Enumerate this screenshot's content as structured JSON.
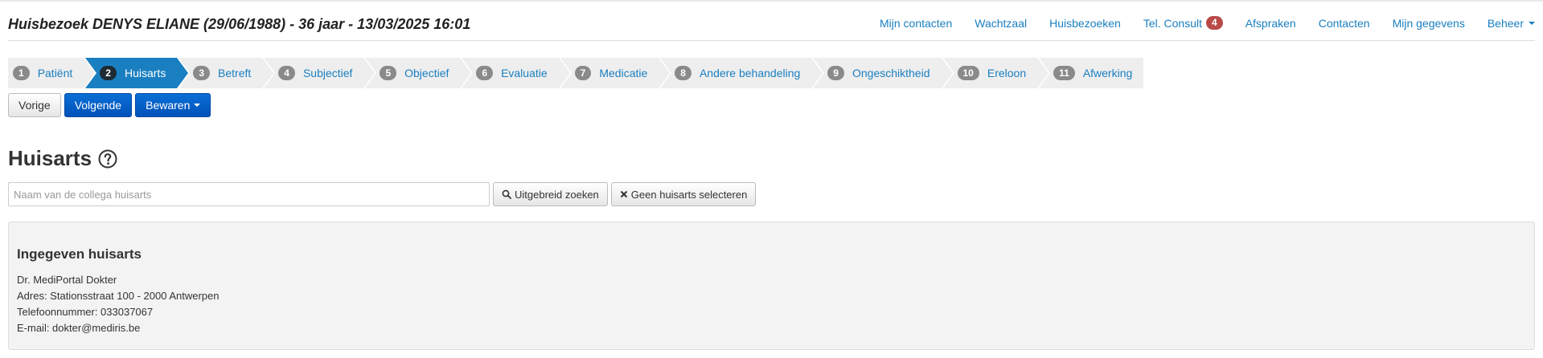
{
  "header": {
    "title": "Huisbezoek DENYS ELIANE (29/06/1988) - 36 jaar - 13/03/2025 16:01"
  },
  "topnav": {
    "items": [
      {
        "label": "Mijn contacten"
      },
      {
        "label": "Wachtzaal"
      },
      {
        "label": "Huisbezoeken"
      },
      {
        "label": "Tel. Consult",
        "badge": "4"
      },
      {
        "label": "Afspraken"
      },
      {
        "label": "Contacten"
      },
      {
        "label": "Mijn gegevens"
      },
      {
        "label": "Beheer"
      }
    ]
  },
  "steps": [
    {
      "num": "1",
      "label": "Patiënt"
    },
    {
      "num": "2",
      "label": "Huisarts",
      "active": true
    },
    {
      "num": "3",
      "label": "Betreft"
    },
    {
      "num": "4",
      "label": "Subjectief"
    },
    {
      "num": "5",
      "label": "Objectief"
    },
    {
      "num": "6",
      "label": "Evaluatie"
    },
    {
      "num": "7",
      "label": "Medicatie"
    },
    {
      "num": "8",
      "label": "Andere behandeling"
    },
    {
      "num": "9",
      "label": "Ongeschiktheid"
    },
    {
      "num": "10",
      "label": "Ereloon"
    },
    {
      "num": "11",
      "label": "Afwerking"
    }
  ],
  "actions": {
    "prev_label": "Vorige",
    "next_label": "Volgende",
    "save_label": "Bewaren"
  },
  "section": {
    "title": "Huisarts"
  },
  "search": {
    "placeholder": "Naam van de collega huisarts",
    "value": "",
    "advanced_label": "Uitgebreid zoeken",
    "none_label": "Geen huisarts selecteren"
  },
  "panel": {
    "title": "Ingegeven huisarts",
    "lines": [
      "Dr. MediPortal Dokter",
      "Adres: Stationsstraat 100 - 2000 Antwerpen",
      "Telefoonnummer: 033037067",
      "E-mail: dokter@mediris.be"
    ]
  },
  "colors": {
    "link": "#1a7fc1",
    "active_step": "#1a7fc1",
    "primary_button": "#0a6fd6",
    "badge": "#b94a48",
    "panel_bg": "#f3f3f3"
  },
  "icons": {
    "help": "question-circle-icon",
    "search": "search-icon",
    "close": "close-icon",
    "caret": "caret-down-icon"
  }
}
